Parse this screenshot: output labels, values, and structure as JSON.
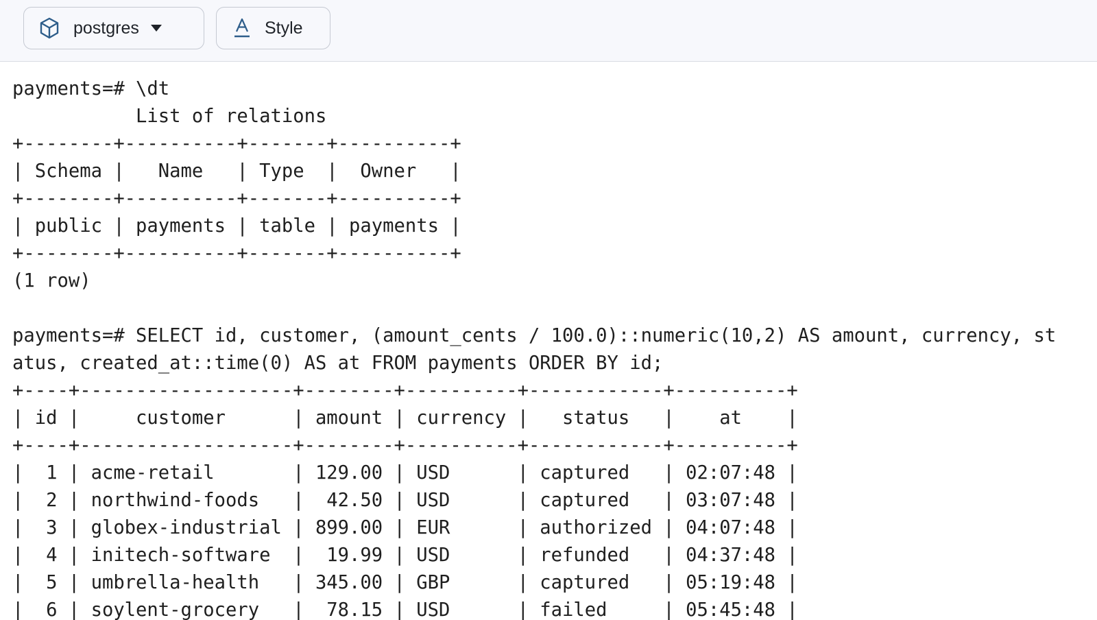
{
  "toolbar": {
    "database_label": "postgres",
    "database_icon": "cube-icon",
    "dropdown_icon": "caret-down-icon",
    "style_label": "Style",
    "style_icon": "text-style-icon",
    "accent_color": "#2d5d8a"
  },
  "terminal": {
    "lines": [
      "payments=# \\dt",
      "           List of relations",
      "+--------+----------+-------+----------+",
      "| Schema |   Name   | Type  |  Owner   |",
      "+--------+----------+-------+----------+",
      "| public | payments | table | payments |",
      "+--------+----------+-------+----------+",
      "(1 row)",
      "",
      "payments=# SELECT id, customer, (amount_cents / 100.0)::numeric(10,2) AS amount, currency, st",
      "atus, created_at::time(0) AS at FROM payments ORDER BY id;",
      "+----+-------------------+--------+----------+------------+----------+",
      "| id |     customer      | amount | currency |   status   |    at    |",
      "+----+-------------------+--------+----------+------------+----------+",
      "|  1 | acme-retail       | 129.00 | USD      | captured   | 02:07:48 |",
      "|  2 | northwind-foods   |  42.50 | USD      | captured   | 03:07:48 |",
      "|  3 | globex-industrial | 899.00 | EUR      | authorized | 04:07:48 |",
      "|  4 | initech-software  |  19.99 | USD      | refunded   | 04:37:48 |",
      "|  5 | umbrella-health   | 345.00 | GBP      | captured   | 05:19:48 |",
      "|  6 | soylent-grocery   |  78.15 | USD      | failed     | 05:45:48 |"
    ]
  }
}
